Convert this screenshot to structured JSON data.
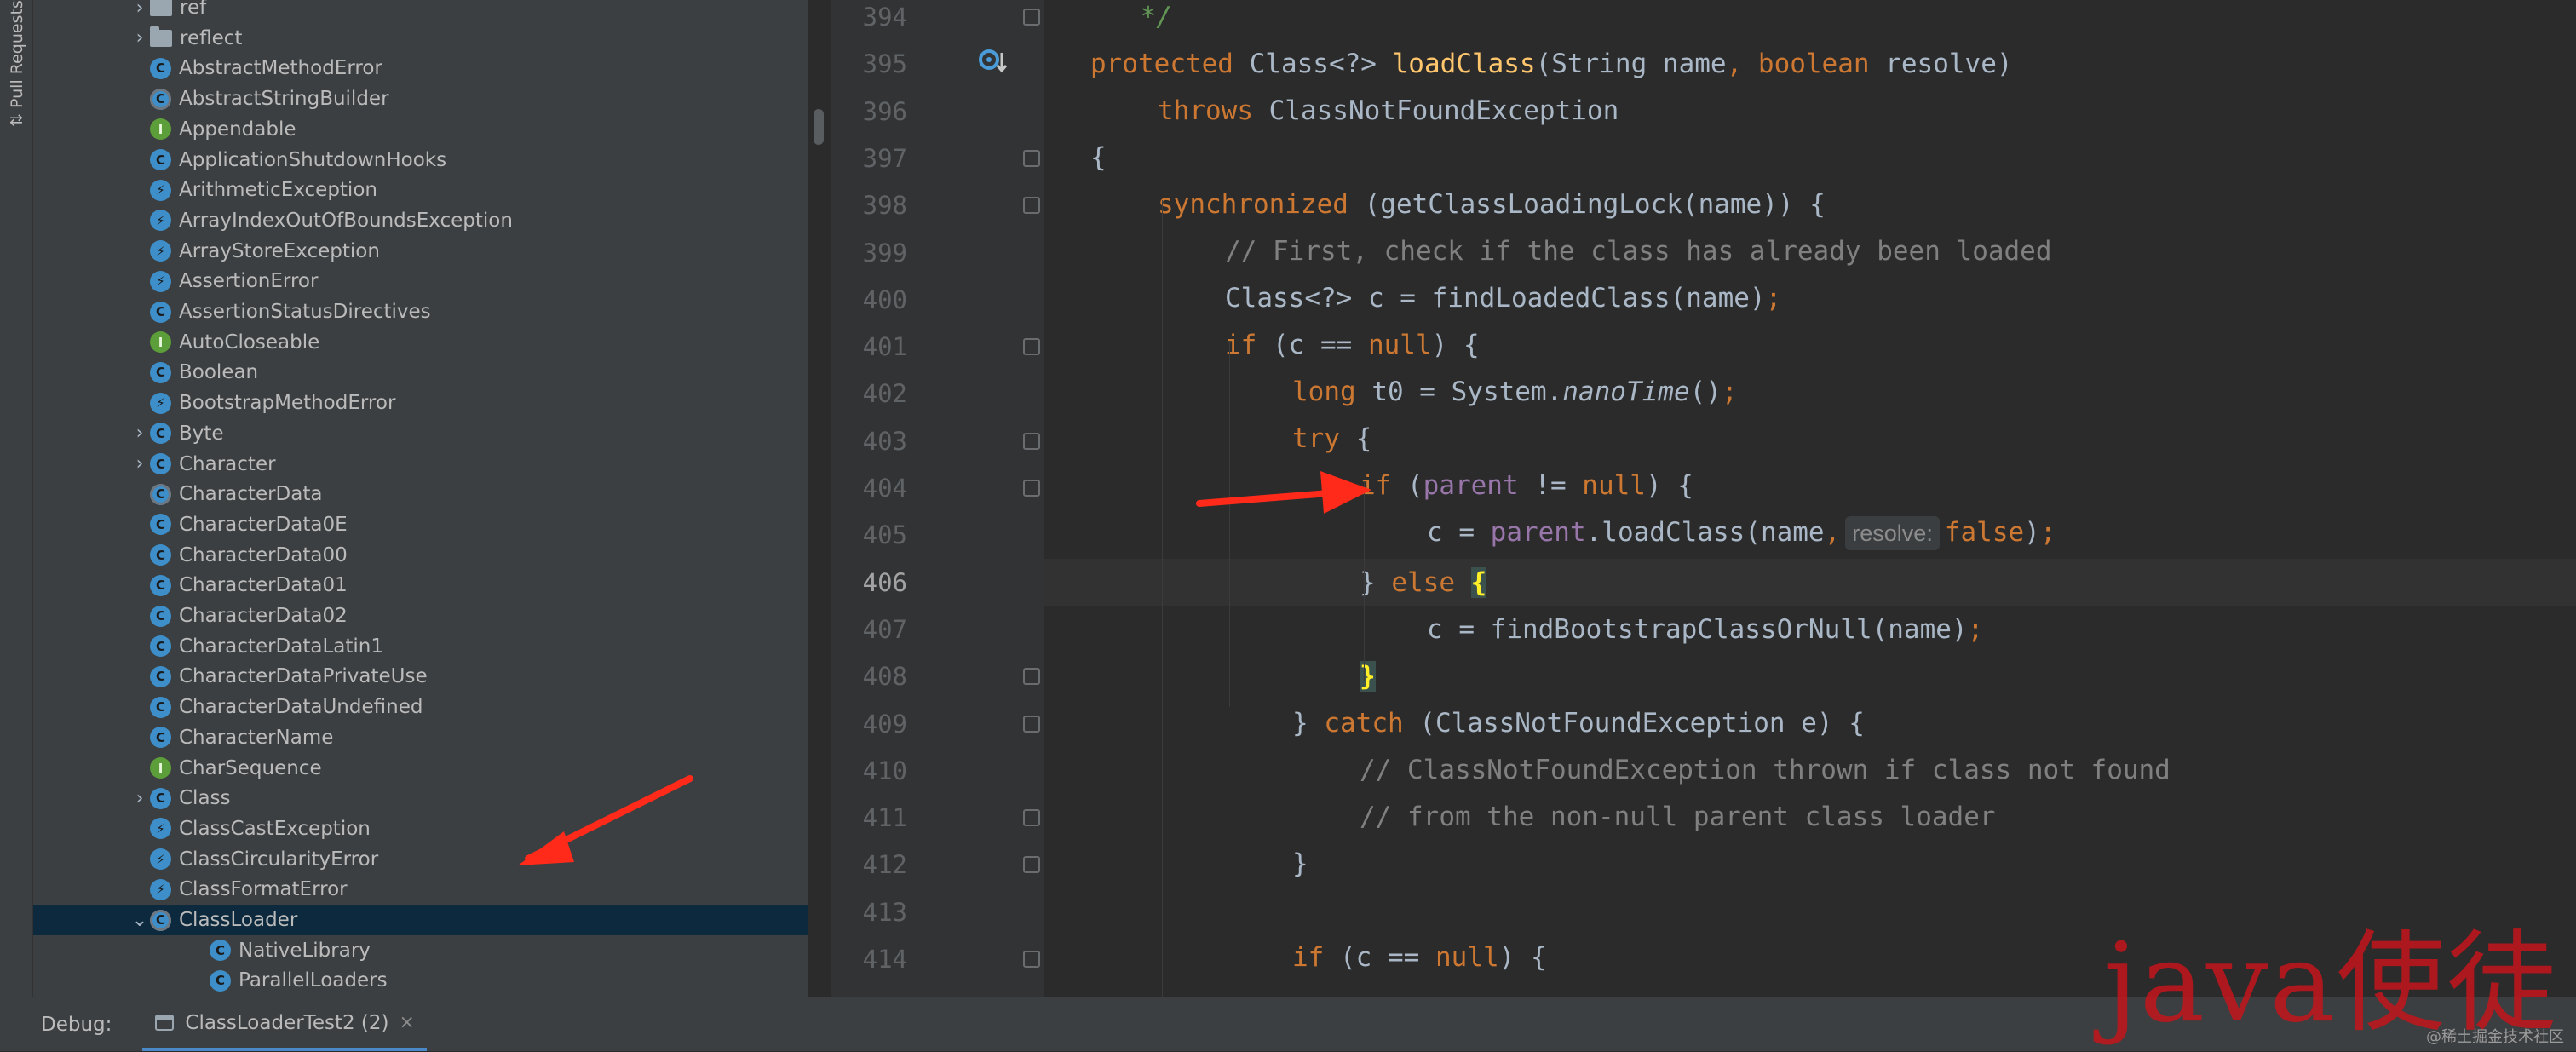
{
  "left_stripe": {
    "label": "Pull Requests"
  },
  "project_tree": {
    "items": [
      {
        "label": "ref",
        "kind": "folder",
        "chevron": "right",
        "indent": 1
      },
      {
        "label": "reflect",
        "kind": "folder",
        "chevron": "right",
        "indent": 1
      },
      {
        "label": "AbstractMethodError",
        "kind": "class"
      },
      {
        "label": "AbstractStringBuilder",
        "kind": "abstract"
      },
      {
        "label": "Appendable",
        "kind": "interface"
      },
      {
        "label": "ApplicationShutdownHooks",
        "kind": "class"
      },
      {
        "label": "ArithmeticException",
        "kind": "exception"
      },
      {
        "label": "ArrayIndexOutOfBoundsException",
        "kind": "exception"
      },
      {
        "label": "ArrayStoreException",
        "kind": "exception"
      },
      {
        "label": "AssertionError",
        "kind": "exception"
      },
      {
        "label": "AssertionStatusDirectives",
        "kind": "class"
      },
      {
        "label": "AutoCloseable",
        "kind": "interface"
      },
      {
        "label": "Boolean",
        "kind": "class"
      },
      {
        "label": "BootstrapMethodError",
        "kind": "exception"
      },
      {
        "label": "Byte",
        "kind": "class",
        "chevron": "right"
      },
      {
        "label": "Character",
        "kind": "class",
        "chevron": "right"
      },
      {
        "label": "CharacterData",
        "kind": "abstract"
      },
      {
        "label": "CharacterData0E",
        "kind": "class"
      },
      {
        "label": "CharacterData00",
        "kind": "class"
      },
      {
        "label": "CharacterData01",
        "kind": "class"
      },
      {
        "label": "CharacterData02",
        "kind": "class"
      },
      {
        "label": "CharacterDataLatin1",
        "kind": "class"
      },
      {
        "label": "CharacterDataPrivateUse",
        "kind": "class"
      },
      {
        "label": "CharacterDataUndefined",
        "kind": "class"
      },
      {
        "label": "CharacterName",
        "kind": "class"
      },
      {
        "label": "CharSequence",
        "kind": "interface"
      },
      {
        "label": "Class",
        "kind": "class",
        "chevron": "right"
      },
      {
        "label": "ClassCastException",
        "kind": "exception"
      },
      {
        "label": "ClassCircularityError",
        "kind": "exception"
      },
      {
        "label": "ClassFormatError",
        "kind": "exception"
      },
      {
        "label": "ClassLoader",
        "kind": "abstract",
        "chevron": "down",
        "selected": true
      },
      {
        "label": "NativeLibrary",
        "kind": "class",
        "indent": 2
      },
      {
        "label": "ParallelLoaders",
        "kind": "class",
        "indent": 2
      }
    ]
  },
  "editor": {
    "line_numbers": [
      "394",
      "395",
      "396",
      "397",
      "398",
      "399",
      "400",
      "401",
      "402",
      "403",
      "404",
      "405",
      "406",
      "407",
      "408",
      "409",
      "410",
      "411",
      "412",
      "413",
      "414"
    ],
    "current_line": "406",
    "code": {
      "l394": " */",
      "l395_kw": "protected",
      "l395_a": " Class<?> ",
      "l395_fn": "loadClass",
      "l395_b": "(String name",
      "l395_c": ", ",
      "l395_kw2": "boolean",
      "l395_d": " resolve)",
      "l396_kw": "throws",
      "l396_a": " ClassNotFoundException",
      "l397": "{",
      "l398_kw": "synchronized",
      "l398_a": " (getClassLoadingLock(name)) {",
      "l399": "// First, check if the class has already been loaded",
      "l400_a": "Class<?> c = findLoadedClass(name)",
      "l400_semi": ";",
      "l401_kw": "if",
      "l401_a": " (c == ",
      "l401_kw2": "null",
      "l401_b": ") {",
      "l402_kw": "long",
      "l402_a": " t0 = System.",
      "l402_it": "nanoTime",
      "l402_b": "()",
      "l402_semi": ";",
      "l403_kw": "try",
      "l403_a": " {",
      "l404_kw": "if",
      "l404_a": " (",
      "l404_fld": "parent",
      "l404_b": " != ",
      "l404_kw2": "null",
      "l404_c": ") {",
      "l405_a": "c = ",
      "l405_fld": "parent",
      "l405_b": ".loadClass(name",
      "l405_comma": ",",
      "l405_hint": "resolve:",
      "l405_kw": "false",
      "l405_c": ")",
      "l405_semi": ";",
      "l406_a": "} ",
      "l406_kw": "else",
      "l406_brace": "{",
      "l407_a": "c = findBootstrapClassOrNull(name)",
      "l407_semi": ";",
      "l408_brace": "}",
      "l409_a": "} ",
      "l409_kw": "catch",
      "l409_b": " (ClassNotFoundException e) {",
      "l410": "// ClassNotFoundException thrown if class not found",
      "l411": "// from the non-null parent class loader",
      "l412": "}",
      "l414_kw": "if",
      "l414_a": " (c == ",
      "l414_kw2": "null",
      "l414_b": ") {"
    }
  },
  "debug_bar": {
    "label": "Debug:",
    "tab_label": "ClassLoaderTest2 (2)",
    "close": "×"
  },
  "watermark": {
    "text": "java使徒",
    "community": "@稀土掘金技术社区"
  },
  "colors": {
    "keyword": "#cc7832",
    "function": "#ffc66d",
    "comment": "#808080",
    "field": "#9876aa",
    "selection": "#0d293e",
    "arrow": "#ff2a1a"
  }
}
